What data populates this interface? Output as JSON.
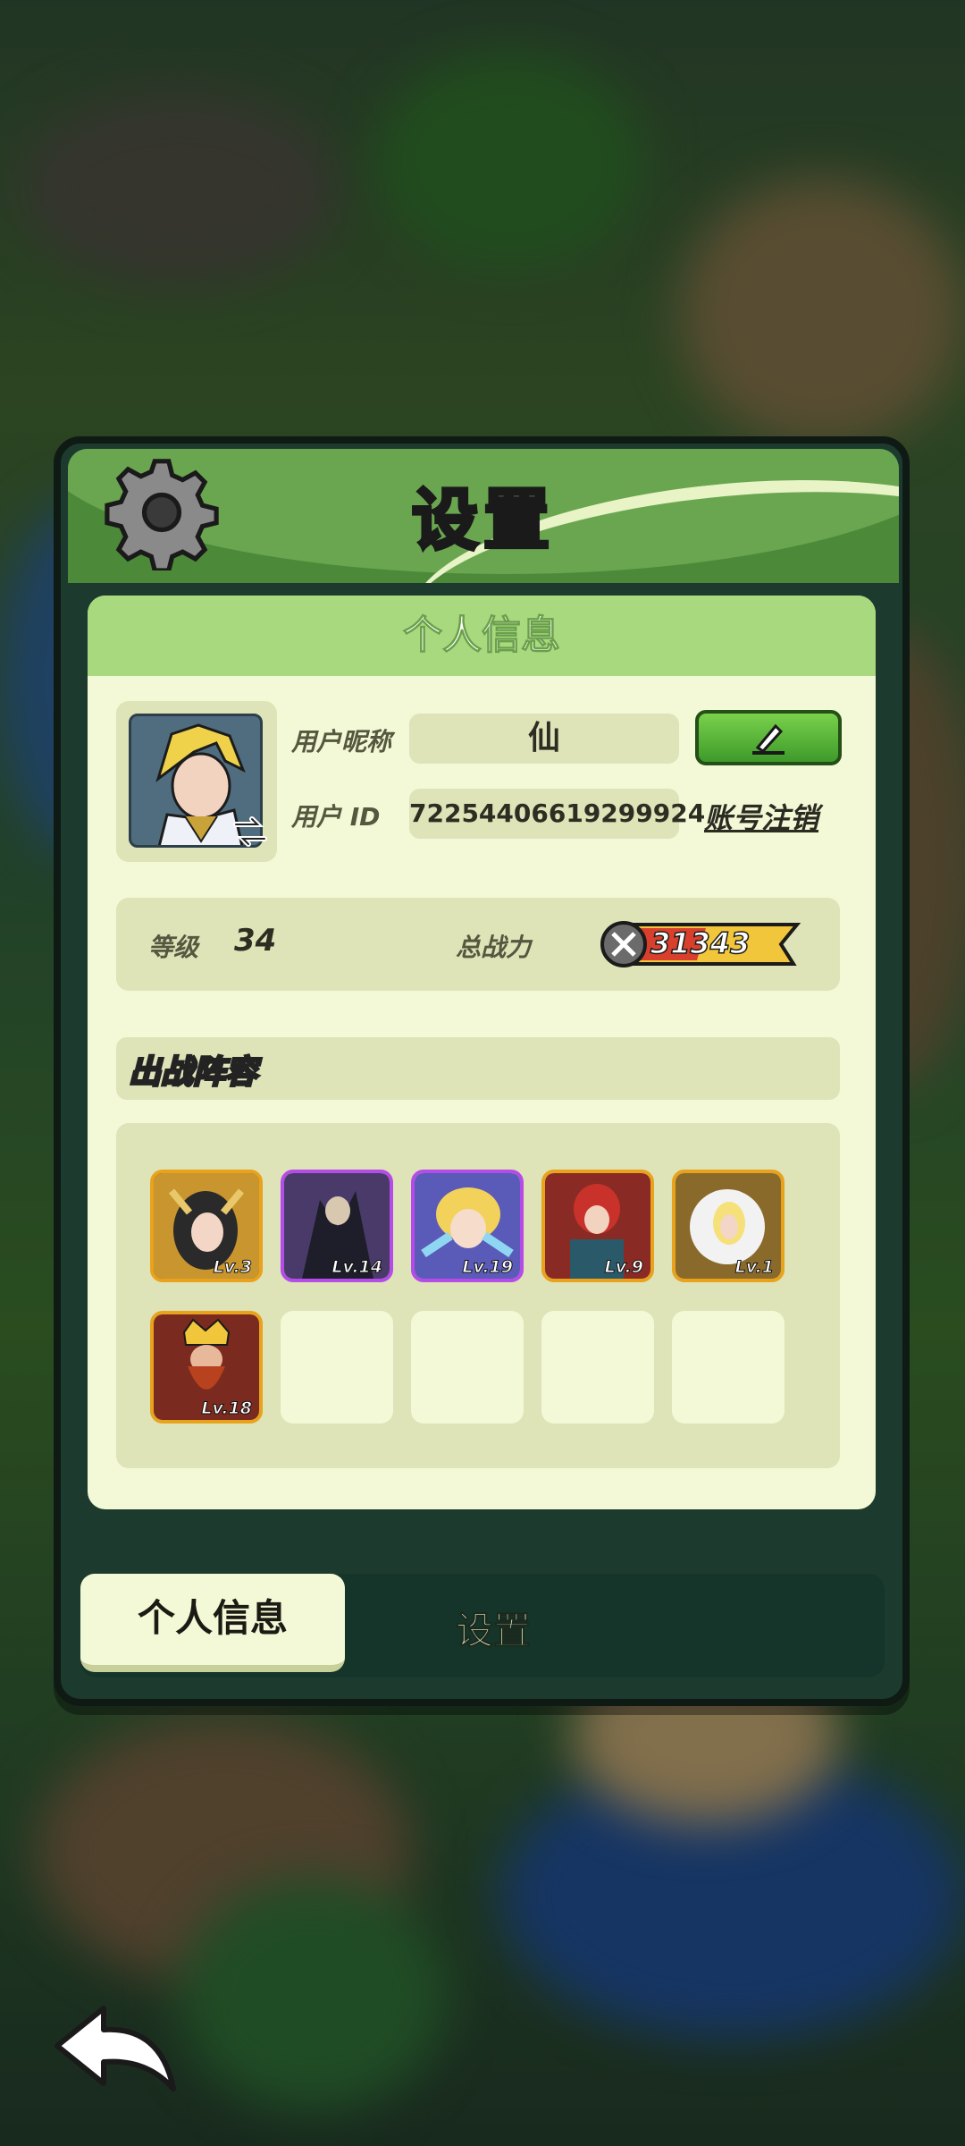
{
  "title": "设置",
  "card_title": "个人信息",
  "profile": {
    "nickname_label": "用户昵称",
    "nickname_value": "仙",
    "id_label": "用户 ID",
    "id_value": "72254406619299924",
    "edit_icon": "pencil-icon",
    "cancel_account": "账号注销"
  },
  "stats": {
    "level_label": "等级",
    "level_value": "34",
    "power_label": "总战力",
    "power_value": "31343"
  },
  "lineup": {
    "title": "出战阵容",
    "heroes": [
      {
        "level": "Lv.3",
        "frame": "orange"
      },
      {
        "level": "Lv.14",
        "frame": "purple"
      },
      {
        "level": "Lv.19",
        "frame": "purple"
      },
      {
        "level": "Lv.9",
        "frame": "orange"
      },
      {
        "level": "Lv.1",
        "frame": "orange"
      },
      {
        "level": "Lv.18",
        "frame": "orange"
      }
    ],
    "empty_slots": 4
  },
  "tabs": {
    "active": "个人信息",
    "other": "设置"
  },
  "colors": {
    "header_green": "#6aa650",
    "card_bg": "#f3f9d6",
    "power_yellow": "#f2c63a",
    "edit_green": "#5cb83a"
  }
}
